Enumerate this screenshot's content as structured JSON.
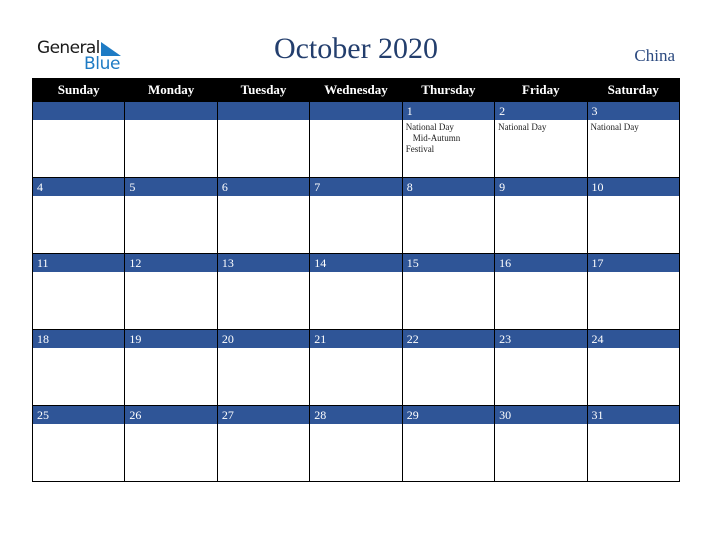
{
  "logo": {
    "word1": "General",
    "word2": "Blue"
  },
  "header": {
    "title": "October 2020",
    "country": "China"
  },
  "colors": {
    "band": "#2f5597",
    "header_bg": "#000000",
    "title": "#233e6d",
    "logo_blue": "#1e7bc4"
  },
  "weekdays": [
    "Sunday",
    "Monday",
    "Tuesday",
    "Wednesday",
    "Thursday",
    "Friday",
    "Saturday"
  ],
  "weeks": [
    [
      {
        "day": "",
        "events": []
      },
      {
        "day": "",
        "events": []
      },
      {
        "day": "",
        "events": []
      },
      {
        "day": "",
        "events": []
      },
      {
        "day": "1",
        "events": [
          "National Day",
          "Mid-Autumn",
          "Festival"
        ]
      },
      {
        "day": "2",
        "events": [
          "National Day"
        ]
      },
      {
        "day": "3",
        "events": [
          "National Day"
        ]
      }
    ],
    [
      {
        "day": "4",
        "events": []
      },
      {
        "day": "5",
        "events": []
      },
      {
        "day": "6",
        "events": []
      },
      {
        "day": "7",
        "events": []
      },
      {
        "day": "8",
        "events": []
      },
      {
        "day": "9",
        "events": []
      },
      {
        "day": "10",
        "events": []
      }
    ],
    [
      {
        "day": "11",
        "events": []
      },
      {
        "day": "12",
        "events": []
      },
      {
        "day": "13",
        "events": []
      },
      {
        "day": "14",
        "events": []
      },
      {
        "day": "15",
        "events": []
      },
      {
        "day": "16",
        "events": []
      },
      {
        "day": "17",
        "events": []
      }
    ],
    [
      {
        "day": "18",
        "events": []
      },
      {
        "day": "19",
        "events": []
      },
      {
        "day": "20",
        "events": []
      },
      {
        "day": "21",
        "events": []
      },
      {
        "day": "22",
        "events": []
      },
      {
        "day": "23",
        "events": []
      },
      {
        "day": "24",
        "events": []
      }
    ],
    [
      {
        "day": "25",
        "events": []
      },
      {
        "day": "26",
        "events": []
      },
      {
        "day": "27",
        "events": []
      },
      {
        "day": "28",
        "events": []
      },
      {
        "day": "29",
        "events": []
      },
      {
        "day": "30",
        "events": []
      },
      {
        "day": "31",
        "events": []
      }
    ]
  ]
}
